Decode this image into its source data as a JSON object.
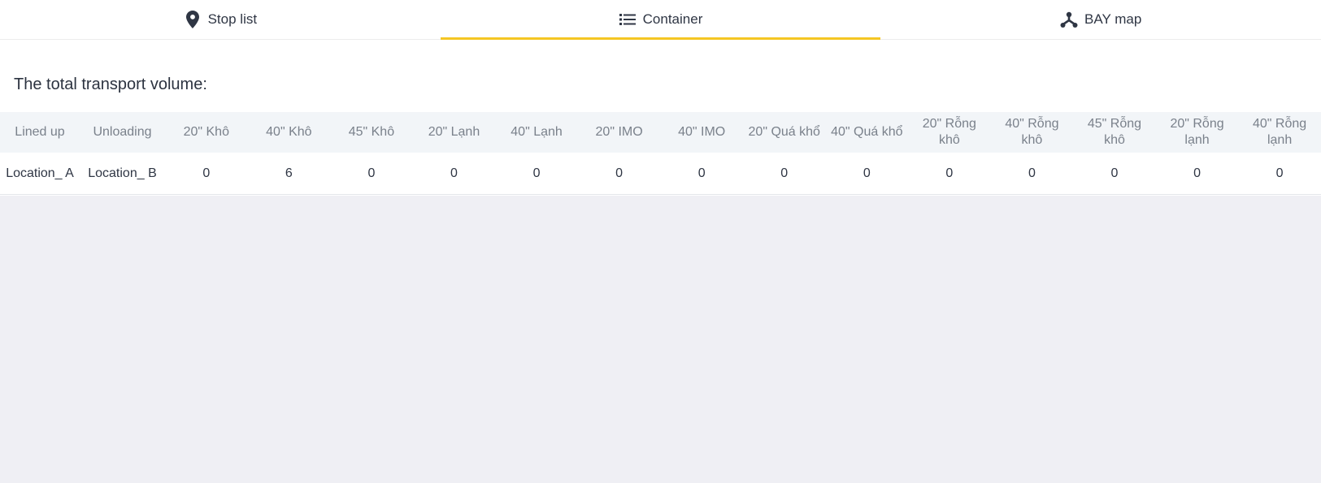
{
  "tabs": [
    {
      "label": "Stop list",
      "icon": "map-pin-icon",
      "active": false
    },
    {
      "label": "Container",
      "icon": "list-icon",
      "active": true
    },
    {
      "label": "BAY map",
      "icon": "hierarchy-icon",
      "active": false
    }
  ],
  "colors": {
    "accent": "#f5c623",
    "header_bg": "#f2f5f8",
    "page_bg": "#efeff4"
  },
  "section": {
    "title": "The total transport volume:"
  },
  "table": {
    "headers": [
      "Lined up",
      "Unloading",
      "20\" Khô",
      "40\" Khô",
      "45\" Khô",
      "20\" Lạnh",
      "40\" Lạnh",
      "20\" IMO",
      "40\" IMO",
      "20\" Quá khổ",
      "40\" Quá khổ",
      "20\" Rỗng khô",
      "40\" Rỗng khô",
      "45\" Rỗng khô",
      "20\" Rỗng lạnh",
      "40\" Rỗng lạnh"
    ],
    "rows": [
      [
        "Location_ A",
        "Location_ B",
        "0",
        "6",
        "0",
        "0",
        "0",
        "0",
        "0",
        "0",
        "0",
        "0",
        "0",
        "0",
        "0",
        "0"
      ]
    ]
  }
}
